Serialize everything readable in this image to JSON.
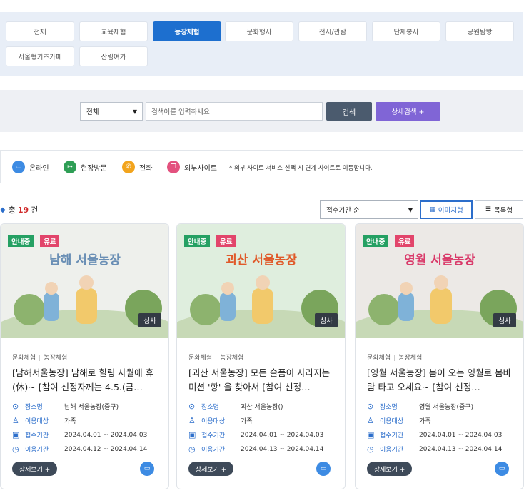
{
  "categories": [
    {
      "label": "전체",
      "active": false
    },
    {
      "label": "교육체험",
      "active": false
    },
    {
      "label": "농장체험",
      "active": true
    },
    {
      "label": "문화행사",
      "active": false
    },
    {
      "label": "전시/관람",
      "active": false
    },
    {
      "label": "단체봉사",
      "active": false
    },
    {
      "label": "공원탐방",
      "active": false
    },
    {
      "label": "서울형키즈카페",
      "active": false
    },
    {
      "label": "산림여가",
      "active": false
    }
  ],
  "search": {
    "scope": "전체",
    "placeholder": "검색어를 입력하세요",
    "search_label": "검색",
    "advanced_label": "상세검색 +"
  },
  "legend": {
    "online": "온라인",
    "visit": "현장방문",
    "phone": "전화",
    "external": "외부사이트",
    "note": "* 외부 사이트 서비스 선택 시 연계 사이트로 이동합니다."
  },
  "results": {
    "total_prefix": "총",
    "total_count": "19",
    "total_suffix": "건",
    "sort": "접수기간 순",
    "view_image": "이미지형",
    "view_list": "목록형"
  },
  "card_labels": {
    "place": "장소명",
    "target": "이용대상",
    "apply": "접수기간",
    "use": "이용기간",
    "more": "상세보기 +"
  },
  "cards": [
    {
      "status": "안내중",
      "fee": "유료",
      "review": "심사",
      "cat1": "문화체험",
      "cat2": "농장체험",
      "title": "[남해서울농장] 남해로 힐링 사월애 휴(休)~ [참여 선정자께는 4.5.(금…",
      "place": "남해 서울농장(중구)",
      "target": "가족",
      "apply": "2024.04.01 ~ 2024.04.03",
      "use": "2024.04.12 ~ 2024.04.14",
      "poster_title": "남해 서울농장",
      "colors": {
        "bg": "#eef0ec",
        "accent": "#6a8fb5"
      }
    },
    {
      "status": "안내중",
      "fee": "유료",
      "review": "심사",
      "cat1": "문화체험",
      "cat2": "농장체험",
      "title": "[괴산 서울농장] 모든 슬픔이 사라지는 미션 '항' 을 찾아서 [참여 선정…",
      "place": "괴산 서울농장()",
      "target": "가족",
      "apply": "2024.04.01 ~ 2024.04.03",
      "use": "2024.04.13 ~ 2024.04.14",
      "poster_title": "괴산 서울농장",
      "colors": {
        "bg": "#dfeede",
        "accent": "#e05a2a"
      }
    },
    {
      "status": "안내중",
      "fee": "유료",
      "review": "심사",
      "cat1": "문화체험",
      "cat2": "농장체험",
      "title": "[영월 서울농장] 봄이 오는 영월로 봄바람 타고 오세요~ [참여 선정…",
      "place": "영월 서울농장(중구)",
      "target": "가족",
      "apply": "2024.04.01 ~ 2024.04.03",
      "use": "2024.04.13 ~ 2024.04.14",
      "poster_title": "영월 서울농장",
      "colors": {
        "bg": "#ece9e6",
        "accent": "#d93a6a"
      }
    }
  ]
}
